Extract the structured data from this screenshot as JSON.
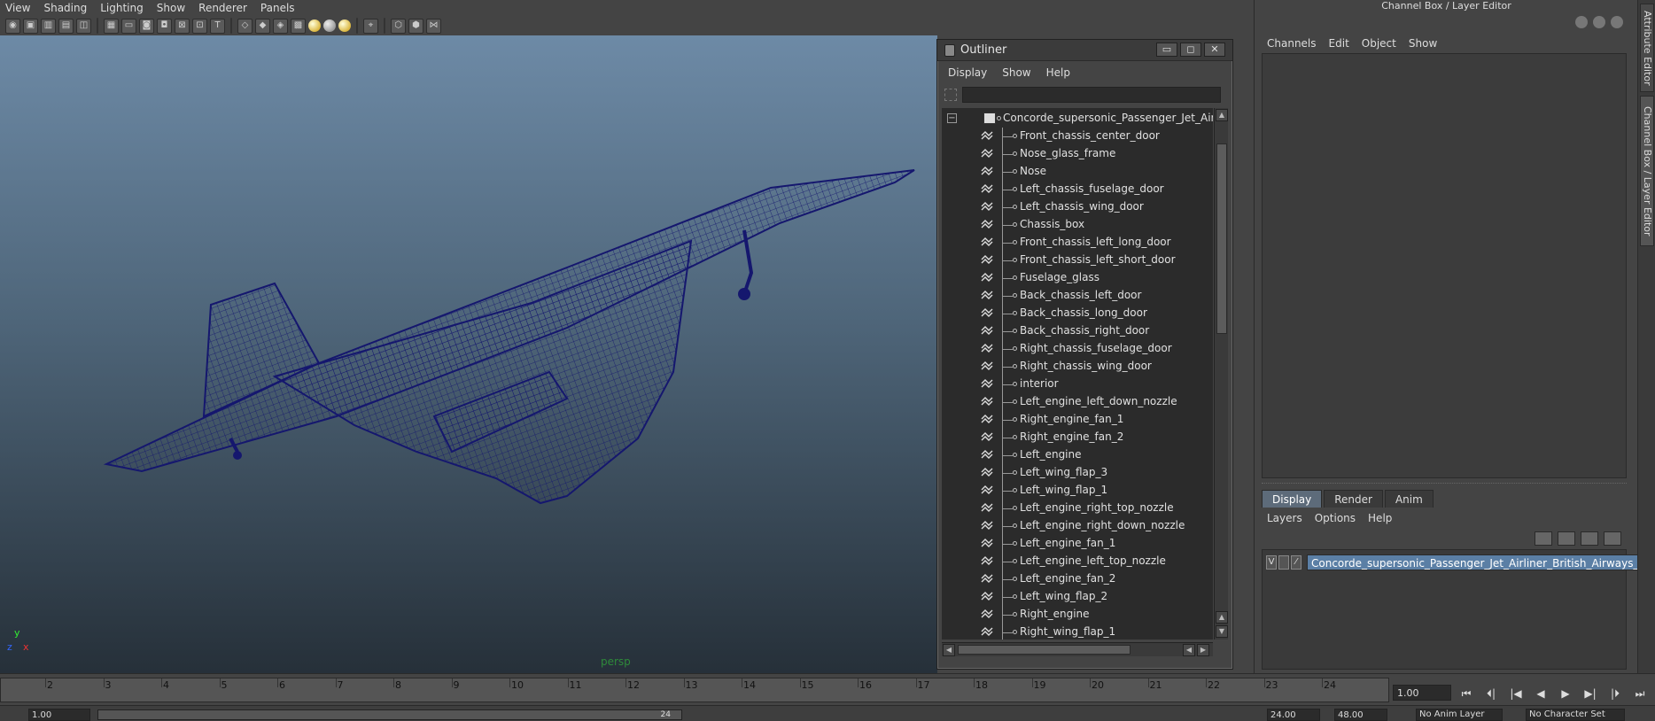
{
  "menubar": [
    "View",
    "Shading",
    "Lighting",
    "Show",
    "Renderer",
    "Panels"
  ],
  "viewport": {
    "camera_label": "persp",
    "axis": {
      "x": "x",
      "y": "y",
      "z": "z"
    }
  },
  "outliner": {
    "title": "Outliner",
    "window_buttons": {
      "minimize": "▭",
      "maximize": "◻",
      "close": "✕"
    },
    "menu": [
      "Display",
      "Show",
      "Help"
    ],
    "search_value": "",
    "root": "Concorde_supersonic_Passenger_Jet_Airliner_B",
    "items": [
      "Front_chassis_center_door",
      "Nose_glass_frame",
      "Nose",
      "Left_chassis_fuselage_door",
      "Left_chassis_wing_door",
      "Chassis_box",
      "Front_chassis_left_long_door",
      "Front_chassis_left_short_door",
      "Fuselage_glass",
      "Back_chassis_left_door",
      "Back_chassis_long_door",
      "Back_chassis_right_door",
      "Right_chassis_fuselage_door",
      "Right_chassis_wing_door",
      "interior",
      "Left_engine_left_down_nozzle",
      "Right_engine_fan_1",
      "Right_engine_fan_2",
      "Left_engine",
      "Left_wing_flap_3",
      "Left_wing_flap_1",
      "Left_engine_right_top_nozzle",
      "Left_engine_right_down_nozzle",
      "Left_engine_fan_1",
      "Left_engine_left_top_nozzle",
      "Left_engine_fan_2",
      "Left_wing_flap_2",
      "Right_engine",
      "Right_wing_flap_1"
    ]
  },
  "channel_box": {
    "title": "Channel Box / Layer Editor",
    "menu": [
      "Channels",
      "Edit",
      "Object",
      "Show"
    ],
    "tabs": [
      "Display",
      "Render",
      "Anim"
    ],
    "active_tab": "Display",
    "layer_menu": [
      "Layers",
      "Options",
      "Help"
    ],
    "layer": {
      "visible": "V",
      "name": "Concorde_supersonic_Passenger_Jet_Airliner_British_Airways_"
    }
  },
  "side_tabs": {
    "attribute_editor": "Attribute Editor",
    "channel_box": "Channel Box / Layer Editor"
  },
  "timeline": {
    "ticks": [
      "2",
      "3",
      "4",
      "5",
      "6",
      "7",
      "8",
      "9",
      "10",
      "11",
      "12",
      "13",
      "14",
      "15",
      "16",
      "17",
      "18",
      "19",
      "20",
      "21",
      "22",
      "23",
      "24"
    ],
    "current_frame": "1.00",
    "playback": [
      "⏮",
      "⏴|",
      "|◀",
      "◀",
      "▶",
      "▶|",
      "|⏵",
      "⏭"
    ]
  },
  "range": {
    "start": "1.00",
    "range_end_label": "24",
    "end": "24.00",
    "max": "48.00",
    "anim_layer": "No Anim Layer",
    "character_set": "No Character Set"
  },
  "colors": {
    "wireframe": "#15176e",
    "selection": "#5b7fa5"
  }
}
